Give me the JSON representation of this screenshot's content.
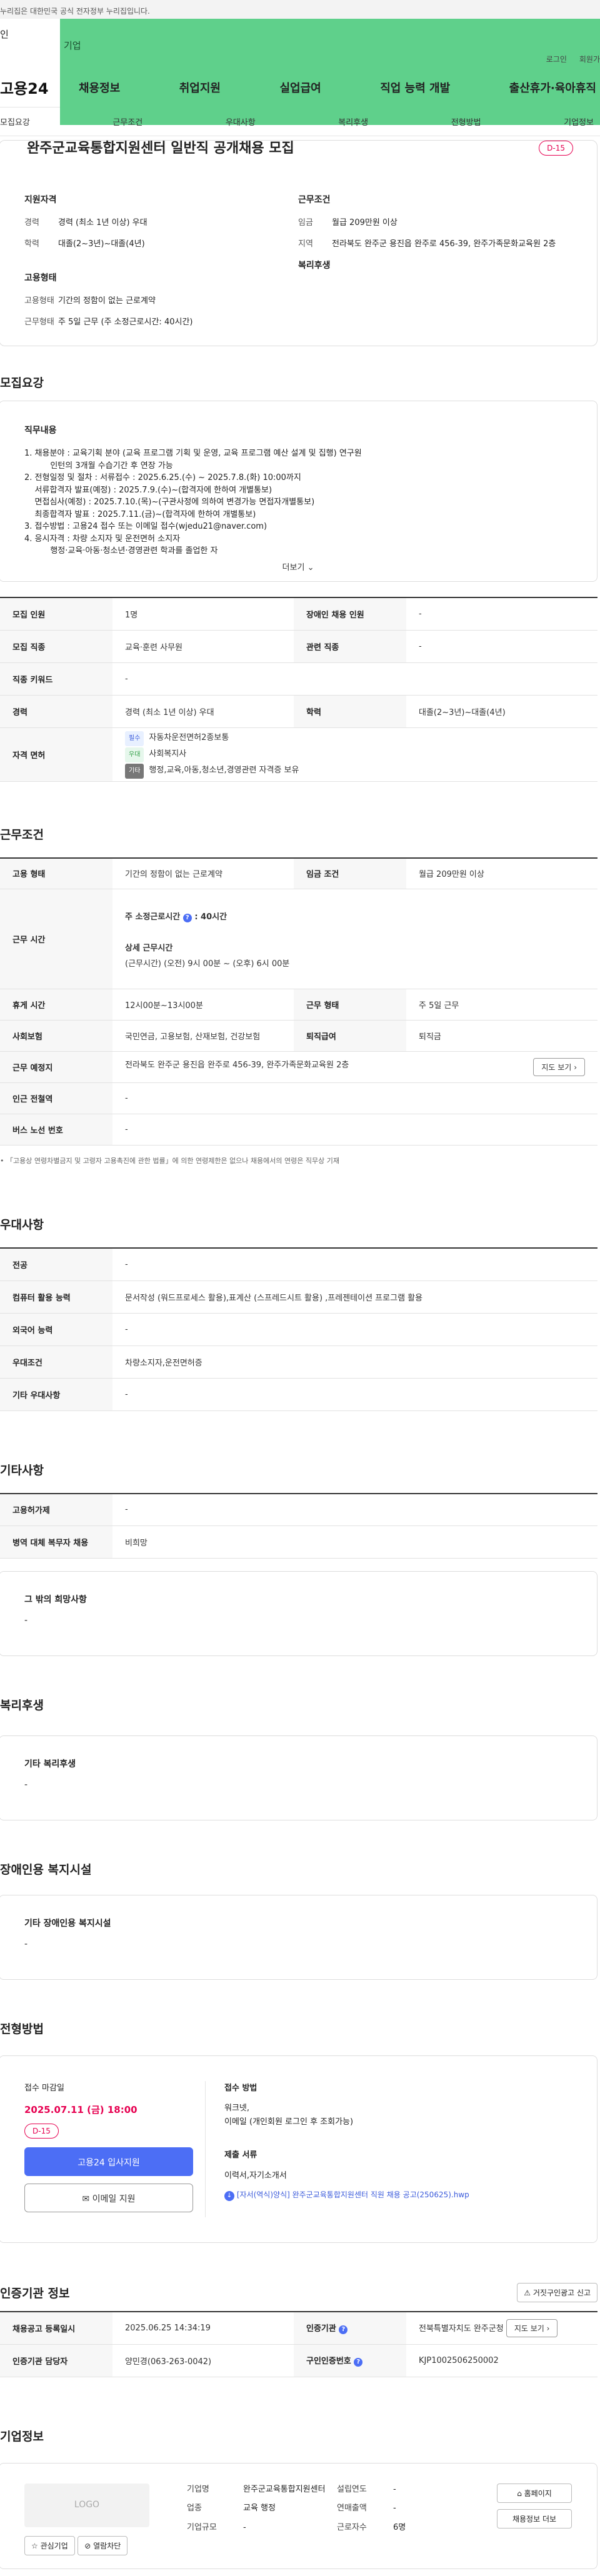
{
  "gov_notice": "누리집은 대한민국 공식 전자정부 누리집입니다.",
  "top_tabs": [
    "인",
    "기업"
  ],
  "util_links": [
    "로그인",
    "회원가"
  ],
  "logo": "고용24",
  "gnb": [
    "채용정보",
    "취업지원",
    "실업급여",
    "직업 능력 개발",
    "출산휴가·육아휴직"
  ],
  "subnav": [
    "모집요강",
    "근무조건",
    "우대사항",
    "복리후생",
    "전형방법",
    "기업정보"
  ],
  "summary": {
    "title": "완주군교육통합지원센터 일반직 공개채용 모집",
    "dday": "D-15",
    "qual_heading": "지원자격",
    "career_k": "경력",
    "career_v": "경력 (최소 1년 이상) 우대",
    "edu_k": "학력",
    "edu_v": "대졸(2~3년)~대졸(4년)",
    "cond_heading": "근무조건",
    "wage_k": "임금",
    "wage_v": "월급 209만원 이상",
    "region_k": "지역",
    "region_v": "전라북도 완주군 용진읍 완주로 456-39, 완주가족문화교육원 2층",
    "emp_heading": "고용형태",
    "emptype_k": "고용형태",
    "emptype_v": "기간의 정함이 없는 근로계약",
    "worktype_k": "근무형태",
    "worktype_v": "주 5일 근무 (주 소정근로시간: 40시간)",
    "welfare_heading": "복리후생"
  },
  "recruit": {
    "title": "모집요강",
    "duty_heading": "직무내용",
    "duty_text": "1. 채용분야 : 교육기획 분야 (교육 프로그램 기획 및 운영, 교육 프로그램 예산 설계 및 집행) 연구원\n          인턴의 3개월 수습기간 후 연장 가능\n2. 전형일정 및 절차 : 서류접수 : 2025.6.25.(수) ~ 2025.7.8.(화) 10:00까지\n    서류합격자 발표(예정) : 2025.7.9.(수)~(합격자에 한하여 개별통보)\n    면접심사(예정) : 2025.7.10.(목)~(구관사정에 의하여 변경가능 면접자개별통보)\n    최종합격자 발표 : 2025.7.11.(금)~(합격자에 한하여 개별통보)\n3. 접수방법 : 고용24 접수 또는 이메일 접수(wjedu21@naver.com)\n4. 응시자격 : 차량 소지자 및 운전면허 소지자\n          행정·교육·아동·청소년·경영관련 학과를 졸업한 자",
    "more": "더보기",
    "rows": {
      "headcount_k": "모집 인원",
      "headcount_v": "1명",
      "disabled_k": "장애인 채용 인원",
      "disabled_v": "-",
      "job_k": "모집 직종",
      "job_v": "교육·훈련 사무원",
      "related_k": "관련 직종",
      "related_v": "-",
      "keyword_k": "직종 키워드",
      "keyword_v": "-",
      "career_k": "경력",
      "career_v": "경력 (최소 1년 이상) 우대",
      "edu_k": "학력",
      "edu_v": "대졸(2~3년)~대졸(4년)",
      "license_k": "자격 면허",
      "license_1_badge": "필수",
      "license_1": "자동차운전면허2종보통",
      "license_2_badge": "우대",
      "license_2": "사회복지사",
      "license_3_badge": "기타",
      "license_3": "행정,교육,아동,청소년,경영관련 자격증 보유"
    }
  },
  "work": {
    "title": "근무조건",
    "emptype_k": "고용 형태",
    "emptype_v": "기간의 정함이 없는 근로계약",
    "wage_k": "임금 조건",
    "wage_v": "월급 209만원 이상",
    "hours_k": "근무 시간",
    "hours_week_label": "주 소정근로시간",
    "hours_week_value": ": 40시간",
    "hours_detail_label": "상세 근무시간",
    "hours_detail_value": "(근무시간) (오전) 9시 00분 ~ (오후) 6시 00분",
    "break_k": "휴게 시간",
    "break_v": "12시00분~13시00분",
    "form_k": "근무 형태",
    "form_v": "주 5일 근무",
    "insurance_k": "사회보험",
    "insurance_v": "국민연금, 고용보험, 산재보험, 건강보험",
    "retire_k": "퇴직급여",
    "retire_v": "퇴직금",
    "place_k": "근무 예정지",
    "place_v": "전라북도 완주군 용진읍 완주로 456-39, 완주가족문화교육원 2층",
    "map_btn": "지도 보기",
    "subway_k": "인근 전철역",
    "subway_v": "-",
    "bus_k": "버스 노선 번호",
    "bus_v": "-",
    "note": "「고용상 연령차별금지 및 고령자 고용촉진에 관한 법률」에 의한 연령제한은 없으나 채용에서의 연령은 직무상 기재"
  },
  "pref": {
    "title": "우대사항",
    "major_k": "전공",
    "major_v": "-",
    "pc_k": "컴퓨터 활용 능력",
    "pc_v": "문서작성 (워드프로세스 활용),표계산 (스프레드시트 활용) ,프레젠테이션 프로그램 활용",
    "lang_k": "외국어 능력",
    "lang_v": "-",
    "cond_k": "우대조건",
    "cond_v": "차량소지자,운전면허증",
    "etc_k": "기타 우대사항",
    "etc_v": "-"
  },
  "other": {
    "title": "기타사항",
    "permit_k": "고용허가제",
    "permit_v": "-",
    "military_k": "병역 대체 복무자 채용",
    "military_v": "비희망",
    "wish_heading": "그 밖의 희망사항",
    "wish_v": "-"
  },
  "welfare": {
    "title": "복리후생",
    "heading": "기타 복리후생",
    "value": "-"
  },
  "disability": {
    "title": "장애인용 복지시설",
    "heading": "기타 장애인용 복지시설",
    "value": "-"
  },
  "process": {
    "title": "전형방법",
    "deadline_label": "접수 마감일",
    "deadline": "2025.07.11 (금) 18:00",
    "dday": "D-15",
    "apply_btn": "고용24 입사지원",
    "email_btn": "이메일 지원",
    "method_label": "접수 방법",
    "method_v1": "워크넷,",
    "method_v2": "이메일 (개인회원 로그인 후 조회가능)",
    "docs_label": "제출 서류",
    "docs_v": "이력서,자기소개서",
    "file": "[자서(역식)양식] 완주군교육통합지원센터 직원 채용 공고(250625).hwp"
  },
  "cert": {
    "title": "인증기관 정보",
    "report_btn": "거짓구인광고 신고",
    "reg_k": "채용공고 등록일시",
    "reg_v": "2025.06.25 14:34:19",
    "org_k": "인증기관",
    "org_v": "전북특별자치도 완주군청",
    "map_btn": "지도 보기",
    "manager_k": "인증기관 담당자",
    "manager_v": "양민경(063-263-0042)",
    "id_k": "구인인증번호",
    "id_v": "KJP1002506250002"
  },
  "company": {
    "title": "기업정보",
    "logo_ph": "LOGO",
    "fav_btn": "관심기업",
    "block_btn": "열람차단",
    "name_k": "기업명",
    "name_v": "완주군교육통합지원센터",
    "industry_k": "업종",
    "industry_v": "교육 행정",
    "size_k": "기업규모",
    "size_v": "-",
    "founded_k": "설립연도",
    "founded_v": "-",
    "sales_k": "연매출액",
    "sales_v": "-",
    "employees_k": "근로자수",
    "employees_v": "6명",
    "homepage_btn": "홈페이지",
    "jobs_btn": "채용정보 더보"
  }
}
